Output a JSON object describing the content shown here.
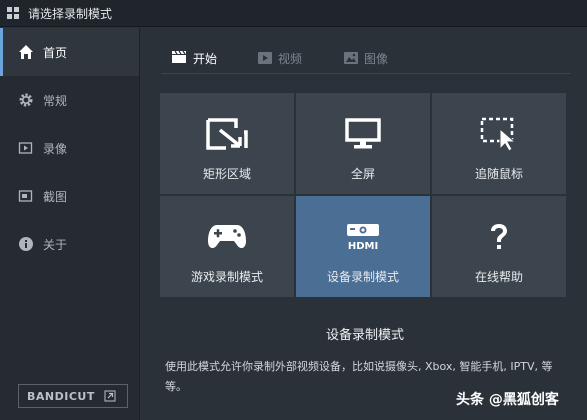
{
  "window": {
    "title": "请选择录制模式"
  },
  "sidebar": {
    "items": [
      {
        "label": "首页",
        "icon": "home-icon",
        "active": true
      },
      {
        "label": "常规",
        "icon": "gear-icon"
      },
      {
        "label": "录像",
        "icon": "video-icon"
      },
      {
        "label": "截图",
        "icon": "screenshot-icon"
      },
      {
        "label": "关于",
        "icon": "info-icon"
      }
    ],
    "brand": "BANDICUT"
  },
  "tabs": [
    {
      "label": "开始",
      "icon": "clapper-icon",
      "active": true
    },
    {
      "label": "视频",
      "icon": "play-icon"
    },
    {
      "label": "图像",
      "icon": "image-icon"
    }
  ],
  "modes": [
    {
      "label": "矩形区域",
      "icon": "rectangle-area-icon"
    },
    {
      "label": "全屏",
      "icon": "monitor-icon"
    },
    {
      "label": "追随鼠标",
      "icon": "cursor-icon"
    },
    {
      "label": "游戏录制模式",
      "icon": "gamepad-icon"
    },
    {
      "label": "设备录制模式",
      "icon": "hdmi-device-icon",
      "selected": true
    },
    {
      "label": "在线帮助",
      "icon": "question-icon"
    }
  ],
  "description": {
    "title": "设备录制模式",
    "text": "使用此模式允许你录制外部视频设备，比如说摄像头, Xbox, 智能手机, IPTV, 等等。"
  },
  "watermark": "头条 @黑狐创客",
  "colors": {
    "accent": "#6aa5de",
    "selected_card": "#4a6e94",
    "card": "#3c444d"
  }
}
